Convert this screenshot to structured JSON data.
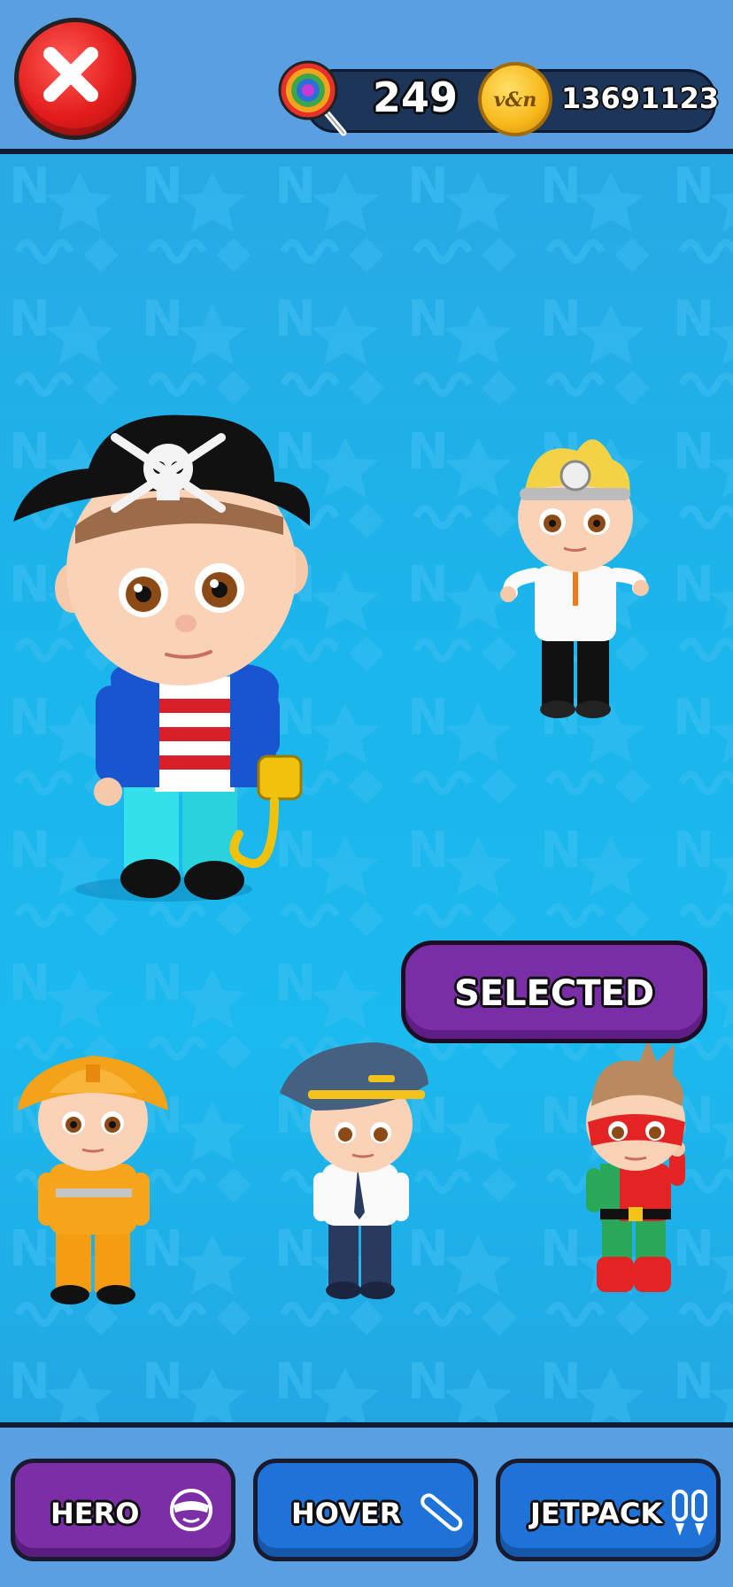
{
  "header": {
    "close_icon": "close-x-icon",
    "candy": {
      "icon": "lollipop-icon",
      "count": "249"
    },
    "coins": {
      "icon": "coin-icon",
      "coin_text": "v&n",
      "count": "13691123"
    }
  },
  "stage": {
    "characters": [
      {
        "name": "pirate",
        "selected": true
      },
      {
        "name": "doctor",
        "selected": false
      },
      {
        "name": "firefighter",
        "selected": false
      },
      {
        "name": "pilot",
        "selected": false
      },
      {
        "name": "superhero",
        "selected": false
      }
    ],
    "selected_button": {
      "label": "SELECTED"
    }
  },
  "tabs": [
    {
      "label": "HERO",
      "icon": "hero-mask-icon",
      "active": true
    },
    {
      "label": "HOVER",
      "icon": "hoverboard-icon",
      "active": false
    },
    {
      "label": "JETPACK",
      "icon": "jetpack-icon",
      "active": false
    }
  ],
  "colors": {
    "accent_purple": "#7b2ea6",
    "tab_blue": "#1f73d8",
    "sky": "#1ab6ec",
    "close_red": "#e31c1c"
  }
}
